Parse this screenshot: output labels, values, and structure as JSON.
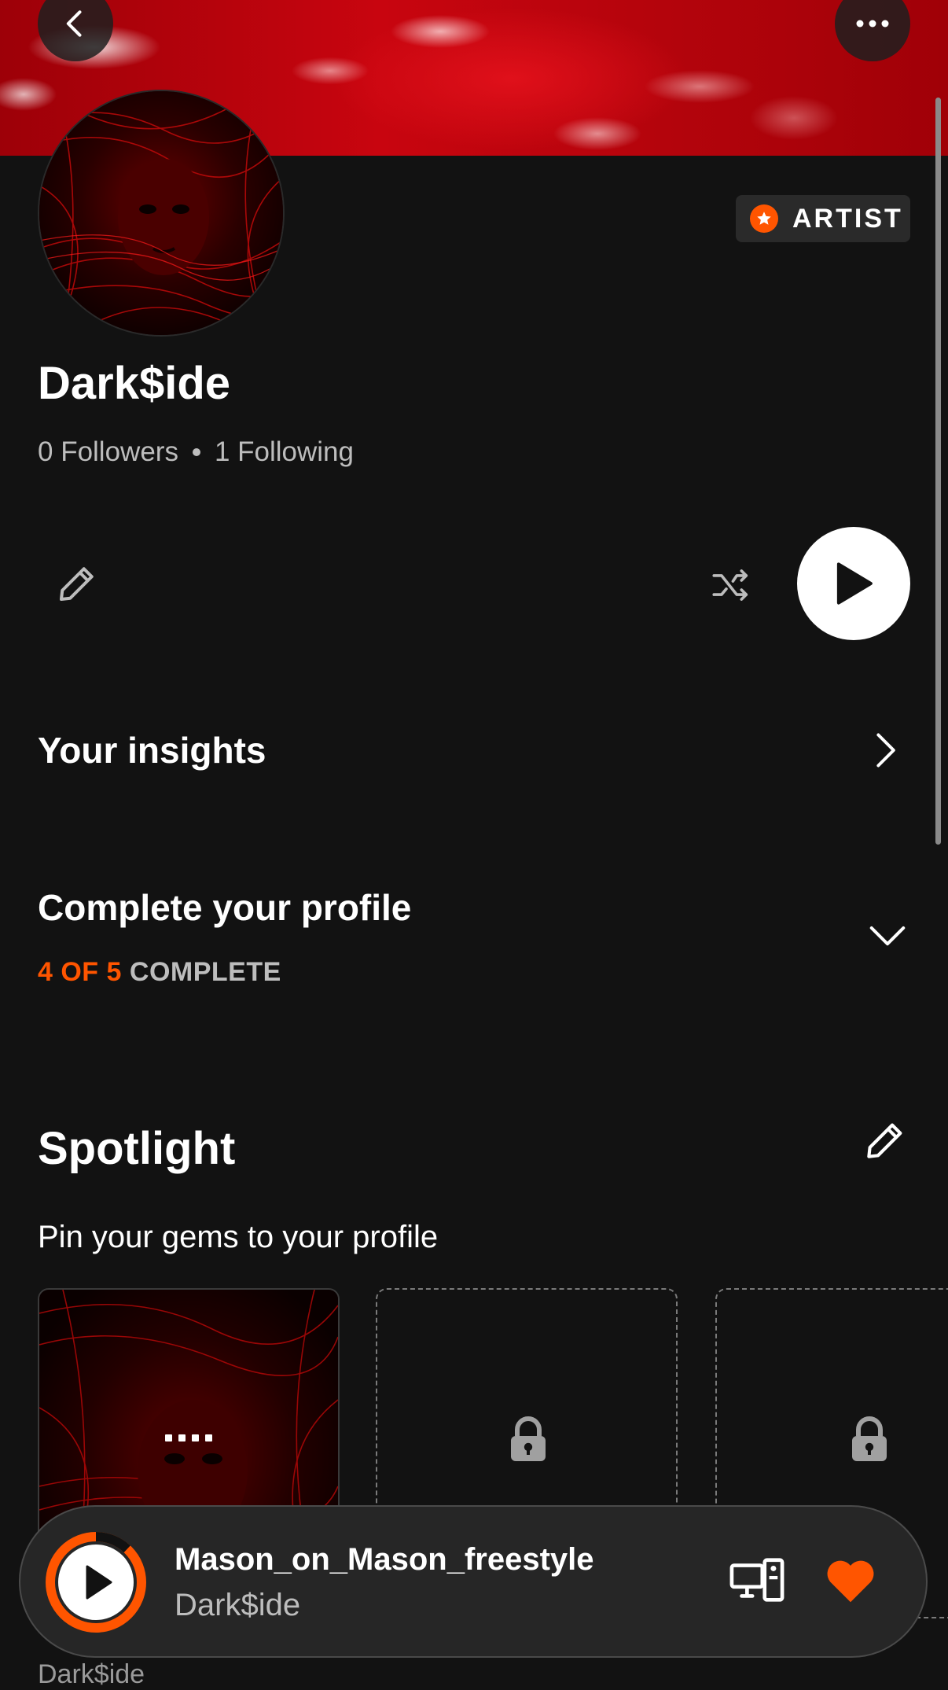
{
  "header": {
    "back_icon": "chevron-left-icon",
    "more_icon": "more-horizontal-icon"
  },
  "profile": {
    "name": "Dark$ide",
    "badge_label": "ARTIST",
    "followers": "0 Followers",
    "following": "1 Following"
  },
  "actions": {
    "edit_icon": "pencil-icon",
    "shuffle_icon": "shuffle-icon",
    "play_icon": "play-icon"
  },
  "insights": {
    "title": "Your insights"
  },
  "complete_profile": {
    "title": "Complete your profile",
    "progress_count": "4 OF 5",
    "progress_label": "COMPLETE"
  },
  "spotlight": {
    "title": "Spotlight",
    "subtitle": "Pin your gems to your profile"
  },
  "below_peek": {
    "artist": "Dark$ide"
  },
  "now_playing": {
    "title": "Mason_on_Mason_freestyle",
    "artist": "Dark$ide",
    "progress": 0.12
  },
  "colors": {
    "accent": "#ff5500",
    "background": "#121212",
    "banner": "#c8050f"
  }
}
